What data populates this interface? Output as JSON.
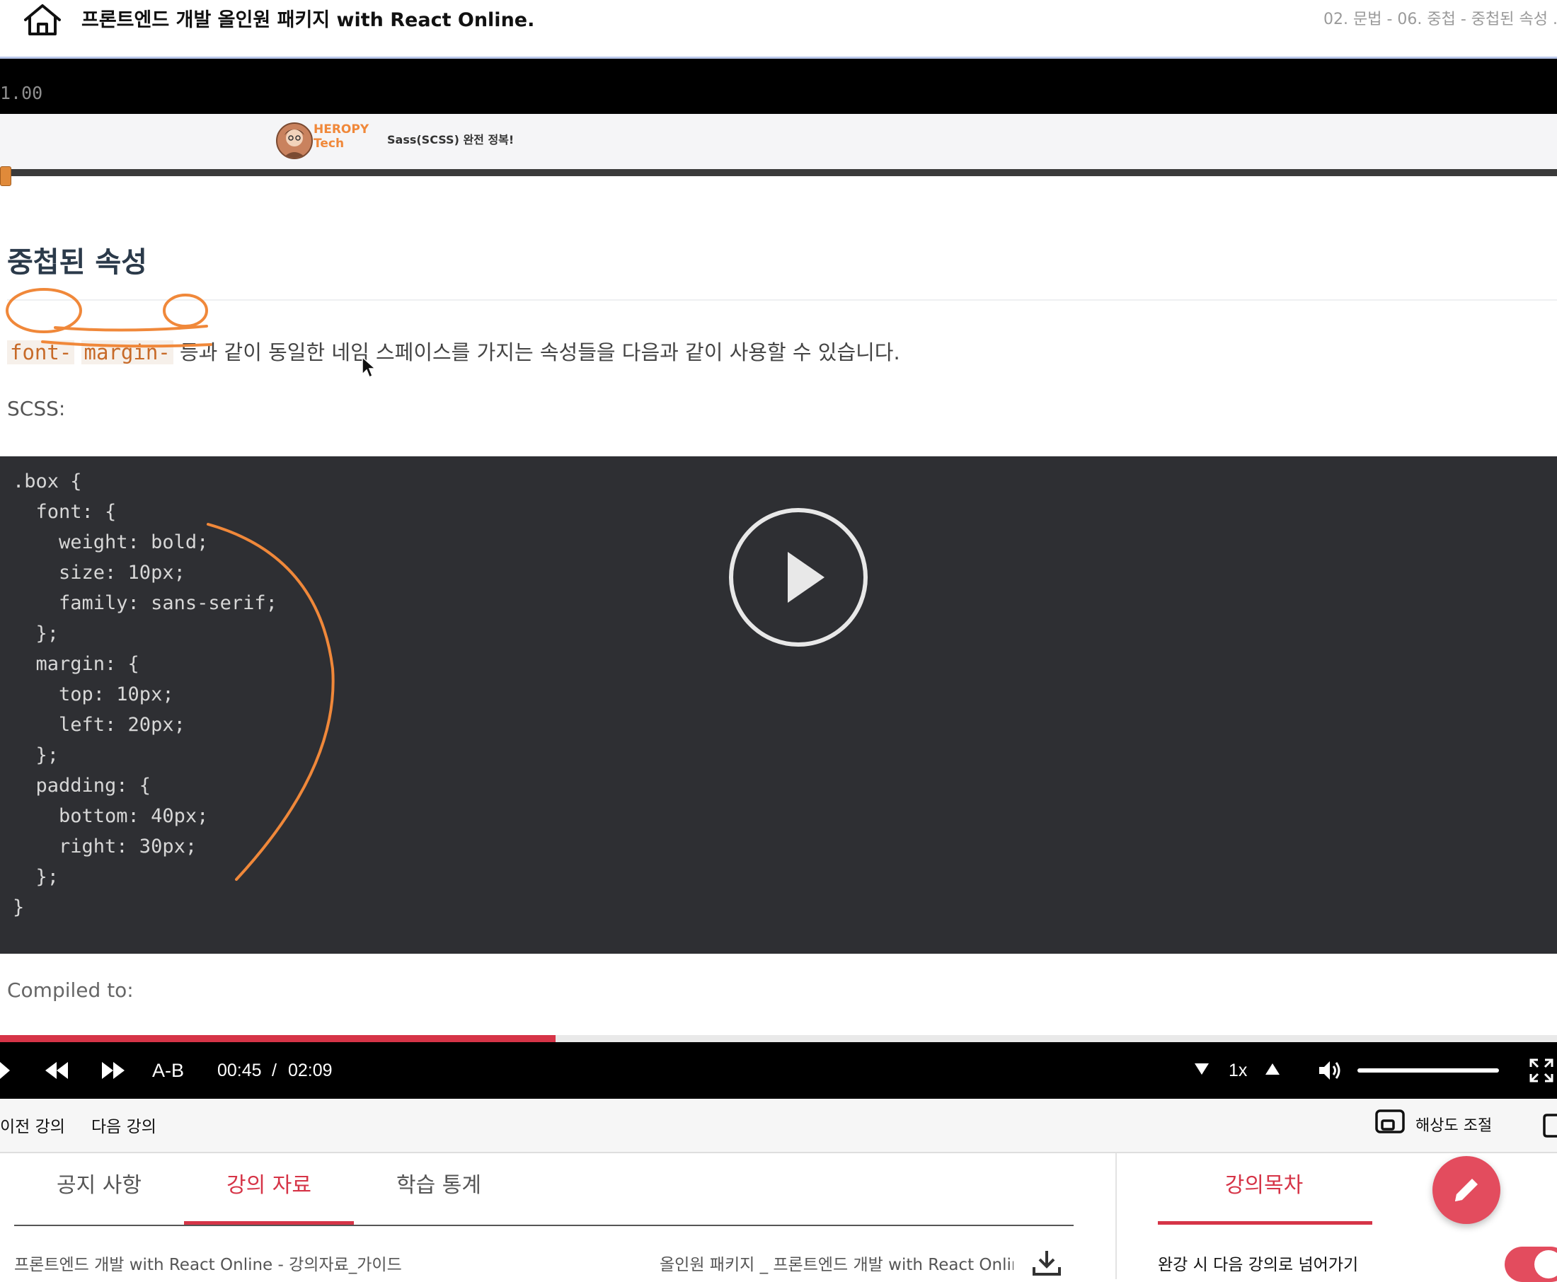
{
  "header": {
    "title": "프론트엔드 개발 올인원 패키지 with React Online.",
    "breadcrumb": "02. 문법 - 06. 중첩 - 중첩된 속성 ...",
    "home_icon": "home-icon"
  },
  "video": {
    "playback_rate_readout": "1.00",
    "slide": {
      "brand_line1": "HEROPY",
      "brand_line2": "Tech",
      "subtitle": "Sass(SCSS) 완전 정복!"
    },
    "doc": {
      "heading": "중첩된 속성",
      "code_term_1": "font-",
      "code_term_2": "margin-",
      "sentence_rest": " 등과 같이 동일한 네임 스페이스를 가지는 속성들을 다음과 같이 사용할 수 있습니다.",
      "scss_label": "SCSS:",
      "compiled_label": "Compiled to:"
    },
    "code_lines": [
      ".box {",
      "  font: {",
      "    weight: bold;",
      "    size: 10px;",
      "    family: sans-serif;",
      "  };",
      "  margin: {",
      "    top: 10px;",
      "    left: 20px;",
      "  };",
      "  padding: {",
      "    bottom: 40px;",
      "    right: 30px;",
      "  };",
      "}"
    ],
    "play_icon": "play-circle-icon",
    "progress_fraction": 0.357
  },
  "controls": {
    "play_icon": "play-icon",
    "rewind_icon": "rewind-icon",
    "forward_icon": "fast-forward-icon",
    "ab_label": "A-B",
    "current_time": "00:45",
    "separator": "/",
    "duration": "02:09",
    "speed_down_icon": "triangle-down-icon",
    "speed_label": "1x",
    "speed_up_icon": "triangle-up-icon",
    "volume_icon": "volume-icon",
    "volume_fraction": 1.0,
    "fullscreen_icon": "fullscreen-icon"
  },
  "nav": {
    "prev_label": "이전 강의",
    "next_label": "다음 강의",
    "resolution_label": "해상도 조절",
    "resolution_icon": "picture-in-picture-icon"
  },
  "tabs": [
    {
      "label": "공지 사항"
    },
    {
      "label": "강의 자료"
    },
    {
      "label": "학습 통계"
    }
  ],
  "materials": {
    "file_name": "프론트엔드 개발 with React Online - 강의자료_가이드",
    "package_name": "올인원 패키지 _ 프론트엔드 개발 with React Onlin⋯",
    "download_icon": "download-icon"
  },
  "toc": {
    "tab_label": "강의목차",
    "autoplay_label": "완강 시 다음 강의로 넘어가기",
    "autoplay_on": true
  },
  "fab": {
    "icon": "pencil-icon"
  },
  "colors": {
    "accent": "#d63447",
    "fab": "#e34c5e",
    "annotation": "#f0883a",
    "code_bg": "#2e2f33"
  }
}
